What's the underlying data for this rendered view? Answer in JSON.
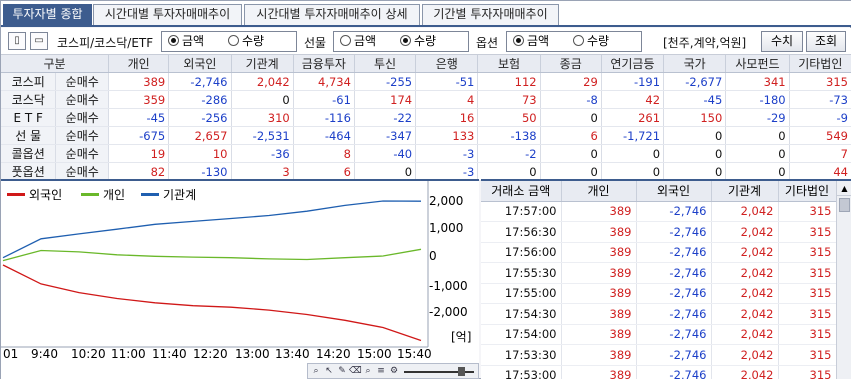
{
  "tabs": [
    {
      "label": "투자자별 종합"
    },
    {
      "label": "시간대별 투자자매매추이"
    },
    {
      "label": "시간대별 투자자매매추이 상세"
    },
    {
      "label": "기간별 투자자매매추이"
    }
  ],
  "toolbar": {
    "market_label": "코스피/코스닥/ETF",
    "market_opt_amount": "금액",
    "market_opt_qty": "수량",
    "futures_label": "선물",
    "futures_opt_amount": "금액",
    "futures_opt_qty": "수량",
    "options_label": "옵션",
    "options_opt_amount": "금액",
    "options_opt_qty": "수량",
    "unit_label": "[천주,계약,억원]",
    "value_button": "수치",
    "query_button": "조회"
  },
  "summary": {
    "col_header_first": "구분",
    "columns": [
      "개인",
      "외국인",
      "기관계",
      "금융투자",
      "투신",
      "은행",
      "보험",
      "종금",
      "연기금등",
      "국가",
      "사모펀드",
      "기타법인"
    ],
    "rows": [
      {
        "market": "코스피",
        "type": "순매수",
        "values": [
          "389",
          "-2,746",
          "2,042",
          "4,734",
          "-255",
          "-51",
          "112",
          "29",
          "-191",
          "-2,677",
          "341",
          "315"
        ]
      },
      {
        "market": "코스닥",
        "type": "순매수",
        "values": [
          "359",
          "-286",
          "0",
          "-61",
          "174",
          "4",
          "73",
          "-8",
          "42",
          "-45",
          "-180",
          "-73"
        ]
      },
      {
        "market": "E T F",
        "type": "순매수",
        "values": [
          "-45",
          "-256",
          "310",
          "-116",
          "-22",
          "16",
          "50",
          "0",
          "261",
          "150",
          "-29",
          "-9"
        ]
      },
      {
        "market": "선 물",
        "type": "순매수",
        "values": [
          "-675",
          "2,657",
          "-2,531",
          "-464",
          "-347",
          "133",
          "-138",
          "6",
          "-1,721",
          "0",
          "0",
          "549"
        ]
      },
      {
        "market": "콜옵션",
        "type": "순매수",
        "values": [
          "19",
          "10",
          "-36",
          "8",
          "-40",
          "-3",
          "-2",
          "0",
          "0",
          "0",
          "0",
          "7"
        ]
      },
      {
        "market": "풋옵션",
        "type": "순매수",
        "values": [
          "82",
          "-130",
          "3",
          "6",
          "0",
          "-3",
          "0",
          "0",
          "0",
          "0",
          "0",
          "44"
        ]
      }
    ]
  },
  "chart": {
    "legend": [
      {
        "name": "외국인",
        "color": "#d01818"
      },
      {
        "name": "개인",
        "color": "#6ab82a"
      },
      {
        "name": "기관계",
        "color": "#1f5fb0"
      }
    ],
    "y_ticks": [
      "2,000",
      "1,000",
      "0",
      "-1,000",
      "-2,000"
    ],
    "y_unit": "[억]",
    "x_ticks": [
      "01",
      "9:40",
      "10:20",
      "11:00",
      "11:40",
      "12:20",
      "13:00",
      "13:40",
      "14:20",
      "15:00",
      "15:40"
    ]
  },
  "chart_data": {
    "type": "line",
    "x": [
      "09:01",
      "09:40",
      "10:20",
      "11:00",
      "11:40",
      "12:20",
      "13:00",
      "13:40",
      "14:20",
      "15:00",
      "15:30",
      "15:40"
    ],
    "series": [
      {
        "name": "외국인",
        "values": [
          -150,
          -800,
          -1100,
          -1300,
          -1450,
          -1550,
          -1600,
          -1700,
          -1850,
          -2050,
          -2300,
          -2746
        ]
      },
      {
        "name": "개인",
        "values": [
          0,
          350,
          300,
          200,
          150,
          120,
          100,
          60,
          40,
          100,
          160,
          389
        ]
      },
      {
        "name": "기관계",
        "values": [
          100,
          750,
          920,
          1080,
          1250,
          1350,
          1450,
          1550,
          1700,
          1900,
          2050,
          2042
        ]
      }
    ],
    "ylim": [
      -2900,
      2600
    ],
    "ylabel": "[억]",
    "grid": false
  },
  "timeline": {
    "headers": [
      "거래소 금액",
      "개인",
      "외국인",
      "기관계",
      "기타법인"
    ],
    "rows": [
      {
        "time": "17:57:00",
        "v": [
          "389",
          "-2,746",
          "2,042",
          "315"
        ]
      },
      {
        "time": "17:56:30",
        "v": [
          "389",
          "-2,746",
          "2,042",
          "315"
        ]
      },
      {
        "time": "17:56:00",
        "v": [
          "389",
          "-2,746",
          "2,042",
          "315"
        ]
      },
      {
        "time": "17:55:30",
        "v": [
          "389",
          "-2,746",
          "2,042",
          "315"
        ]
      },
      {
        "time": "17:55:00",
        "v": [
          "389",
          "-2,746",
          "2,042",
          "315"
        ]
      },
      {
        "time": "17:54:30",
        "v": [
          "389",
          "-2,746",
          "2,042",
          "315"
        ]
      },
      {
        "time": "17:54:00",
        "v": [
          "389",
          "-2,746",
          "2,042",
          "315"
        ]
      },
      {
        "time": "17:53:30",
        "v": [
          "389",
          "-2,746",
          "2,042",
          "315"
        ]
      },
      {
        "time": "17:53:00",
        "v": [
          "389",
          "-2,746",
          "2,042",
          "315"
        ]
      }
    ]
  }
}
